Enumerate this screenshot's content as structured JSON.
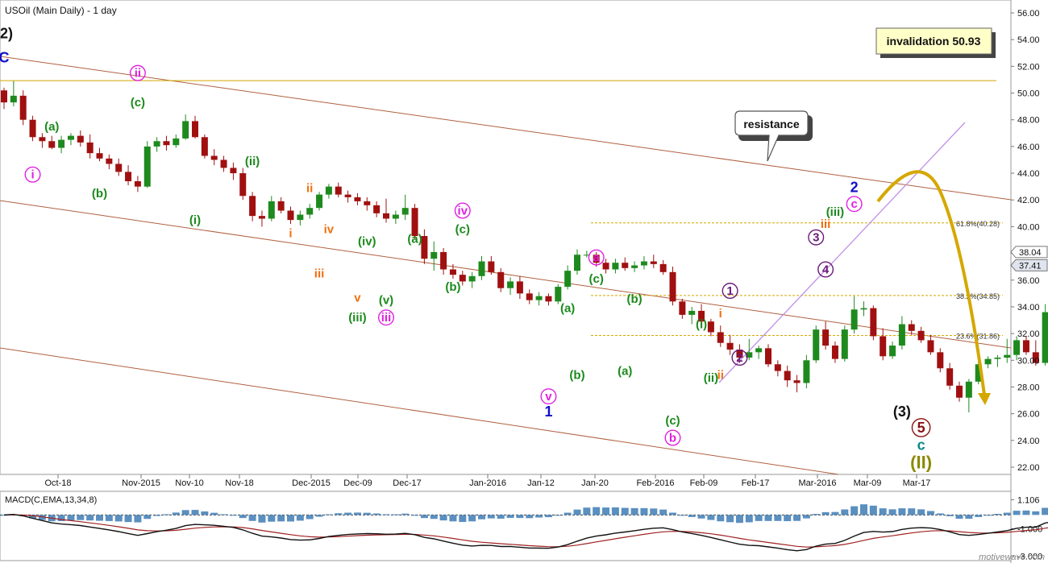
{
  "title": "USOil (Main Daily) - 1 day",
  "watermark": "motivewave.com",
  "colors": {
    "up": "#1e8a1e",
    "down": "#a01010",
    "green": "#1b8a1b",
    "magenta": "#e020e0",
    "orange": "#f07010",
    "blue": "#1010c8",
    "purple": "#6a1a7a",
    "black": "#111111",
    "darkred": "#8a1010",
    "teal": "#0a8a8a",
    "olive": "#8a8a00",
    "gold": "#d4a800",
    "channel": "#b06040",
    "lavender": "#c090e8",
    "macd_hist": "#5a8fc0",
    "macd_line": "#111111",
    "signal_line": "#a02020"
  },
  "price_axis": {
    "min": 22,
    "max": 56,
    "ticks": [
      "56.00",
      "54.00",
      "52.00",
      "50.00",
      "48.00",
      "46.00",
      "44.00",
      "42.00",
      "40.00",
      "38.00",
      "36.00",
      "34.00",
      "32.00",
      "30.00",
      "28.00",
      "26.00",
      "24.00",
      "22.00"
    ]
  },
  "last_price_tags": [
    {
      "label": "38.04",
      "value": 38.04
    },
    {
      "label": "37.41",
      "value": 37.41
    }
  ],
  "date_labels": [
    "Oct-18",
    "Nov-2015",
    "Nov-10",
    "Nov-18",
    "Dec-2015",
    "Dec-09",
    "Dec-17",
    "Jan-2016",
    "Jan-12",
    "Jan-20",
    "Feb-2016",
    "Feb-09",
    "Feb-17",
    "Mar-2016",
    "Mar-09",
    "Mar-17"
  ],
  "invalidation": {
    "label": "invalidation 50.93",
    "value": 50.93
  },
  "resistance_label": "resistance",
  "fib_levels": [
    {
      "label": "61.8%(40.28)",
      "value": 40.28
    },
    {
      "label": "38.2%(34.85)",
      "value": 34.85
    },
    {
      "label": "23.6%(31.86)",
      "value": 31.86
    }
  ],
  "macd": {
    "label": "MACD(C,EMA,13,34,8)",
    "ticks": [
      "1.106",
      "-1.000",
      "-3.000"
    ],
    "min": -3.2,
    "max": 1.6
  },
  "wave_labels": [
    {
      "text": "(2)",
      "bar": 0,
      "price": 54.1,
      "color": "black",
      "size": 18,
      "circle": false
    },
    {
      "text": "C",
      "bar": 0,
      "price": 52.3,
      "color": "blue",
      "size": 18,
      "circle": false
    },
    {
      "text": "ii",
      "bar": 14,
      "price": 51.2,
      "color": "magenta",
      "size": 15,
      "circle": true
    },
    {
      "text": "(c)",
      "bar": 14,
      "price": 49.0,
      "color": "green",
      "size": 15,
      "circle": false
    },
    {
      "text": "(a)",
      "bar": 5,
      "price": 47.2,
      "color": "green",
      "size": 15,
      "circle": false
    },
    {
      "text": "i",
      "bar": 3,
      "price": 43.6,
      "color": "magenta",
      "size": 15,
      "circle": true
    },
    {
      "text": "(b)",
      "bar": 10,
      "price": 42.2,
      "color": "green",
      "size": 15,
      "circle": false
    },
    {
      "text": "(ii)",
      "bar": 26,
      "price": 44.6,
      "color": "green",
      "size": 15,
      "circle": false
    },
    {
      "text": "(i)",
      "bar": 20,
      "price": 40.2,
      "color": "green",
      "size": 15,
      "circle": false
    },
    {
      "text": "ii",
      "bar": 32,
      "price": 42.6,
      "color": "orange",
      "size": 15,
      "circle": false
    },
    {
      "text": "iv",
      "bar": 34,
      "price": 39.5,
      "color": "orange",
      "size": 15,
      "circle": false
    },
    {
      "text": "i",
      "bar": 30,
      "price": 39.2,
      "color": "orange",
      "size": 15,
      "circle": false
    },
    {
      "text": "(iv)",
      "bar": 38,
      "price": 38.6,
      "color": "green",
      "size": 15,
      "circle": false
    },
    {
      "text": "iii",
      "bar": 33,
      "price": 36.2,
      "color": "orange",
      "size": 15,
      "circle": false
    },
    {
      "text": "v",
      "bar": 37,
      "price": 34.4,
      "color": "orange",
      "size": 15,
      "circle": false
    },
    {
      "text": "(v)",
      "bar": 40,
      "price": 34.2,
      "color": "green",
      "size": 15,
      "circle": false
    },
    {
      "text": "(iii)",
      "bar": 37,
      "price": 32.9,
      "color": "green",
      "size": 15,
      "circle": false
    },
    {
      "text": "iii",
      "bar": 40,
      "price": 32.9,
      "color": "magenta",
      "size": 15,
      "circle": true
    },
    {
      "text": "iv",
      "bar": 48,
      "price": 40.9,
      "color": "magenta",
      "size": 15,
      "circle": true
    },
    {
      "text": "(c)",
      "bar": 48,
      "price": 39.5,
      "color": "green",
      "size": 15,
      "circle": false
    },
    {
      "text": "(a)",
      "bar": 43,
      "price": 38.8,
      "color": "green",
      "size": 15,
      "circle": false
    },
    {
      "text": "(b)",
      "bar": 47,
      "price": 35.2,
      "color": "green",
      "size": 15,
      "circle": false
    },
    {
      "text": "a",
      "bar": 62,
      "price": 37.4,
      "color": "magenta",
      "size": 15,
      "circle": true
    },
    {
      "text": "(c)",
      "bar": 62,
      "price": 35.8,
      "color": "green",
      "size": 15,
      "circle": false
    },
    {
      "text": "(a)",
      "bar": 59,
      "price": 33.6,
      "color": "green",
      "size": 15,
      "circle": false
    },
    {
      "text": "(b)",
      "bar": 66,
      "price": 34.3,
      "color": "green",
      "size": 15,
      "circle": false
    },
    {
      "text": "(b)",
      "bar": 60,
      "price": 28.6,
      "color": "green",
      "size": 15,
      "circle": false
    },
    {
      "text": "(a)",
      "bar": 65,
      "price": 28.9,
      "color": "green",
      "size": 15,
      "circle": false
    },
    {
      "text": "v",
      "bar": 57,
      "price": 27.0,
      "color": "magenta",
      "size": 15,
      "circle": true
    },
    {
      "text": "1",
      "bar": 57,
      "price": 25.8,
      "color": "blue",
      "size": 18,
      "circle": false
    },
    {
      "text": "(c)",
      "bar": 70,
      "price": 25.2,
      "color": "green",
      "size": 15,
      "circle": false
    },
    {
      "text": "b",
      "bar": 70,
      "price": 23.9,
      "color": "magenta",
      "size": 15,
      "circle": true
    },
    {
      "text": "(i)",
      "bar": 73,
      "price": 32.4,
      "color": "green",
      "size": 15,
      "circle": false
    },
    {
      "text": "(ii)",
      "bar": 74,
      "price": 28.4,
      "color": "green",
      "size": 15,
      "circle": false
    },
    {
      "text": "i",
      "bar": 75,
      "price": 33.2,
      "color": "orange",
      "size": 15,
      "circle": false
    },
    {
      "text": "ii",
      "bar": 75,
      "price": 28.6,
      "color": "orange",
      "size": 15,
      "circle": false
    },
    {
      "text": "1",
      "bar": 76,
      "price": 34.9,
      "color": "purple",
      "size": 15,
      "circle": true
    },
    {
      "text": "2",
      "bar": 77,
      "price": 29.9,
      "color": "purple",
      "size": 15,
      "circle": true
    },
    {
      "text": "2",
      "bar": 89,
      "price": 42.6,
      "color": "blue",
      "size": 18,
      "circle": false
    },
    {
      "text": "c",
      "bar": 89,
      "price": 41.4,
      "color": "magenta",
      "size": 15,
      "circle": true
    },
    {
      "text": "(iii)",
      "bar": 87,
      "price": 40.8,
      "color": "green",
      "size": 15,
      "circle": false
    },
    {
      "text": "iii",
      "bar": 86,
      "price": 39.9,
      "color": "orange",
      "size": 15,
      "circle": false
    },
    {
      "text": "3",
      "bar": 85,
      "price": 38.9,
      "color": "purple",
      "size": 15,
      "circle": true
    },
    {
      "text": "4",
      "bar": 86,
      "price": 36.5,
      "color": "purple",
      "size": 15,
      "circle": true
    },
    {
      "text": "(3)",
      "bar": 94,
      "price": 25.8,
      "color": "black",
      "size": 18,
      "circle": false
    },
    {
      "text": "5",
      "bar": 96,
      "price": 24.6,
      "color": "darkred",
      "size": 18,
      "circle": true
    },
    {
      "text": "c",
      "bar": 96,
      "price": 23.3,
      "color": "teal",
      "size": 18,
      "circle": false
    },
    {
      "text": "(II)",
      "bar": 96,
      "price": 21.9,
      "color": "olive",
      "size": 22,
      "circle": false
    }
  ],
  "chart_data": {
    "type": "candlestick",
    "title": "USOil (Main Daily) - 1 day",
    "y_range": [
      22,
      56
    ],
    "x_tick_labels": [
      "Oct-18",
      "Nov-2015",
      "Nov-10",
      "Nov-18",
      "Dec-2015",
      "Dec-09",
      "Dec-17",
      "Jan-2016",
      "Jan-12",
      "Jan-20",
      "Feb-2016",
      "Feb-09",
      "Feb-17",
      "Mar-2016",
      "Mar-09",
      "Mar-17"
    ],
    "ohlc": [
      [
        50.2,
        50.4,
        48.8,
        49.3
      ],
      [
        49.3,
        50.9,
        49.0,
        49.8
      ],
      [
        49.8,
        50.2,
        47.6,
        48.0
      ],
      [
        48.0,
        48.3,
        46.4,
        46.7
      ],
      [
        46.7,
        47.0,
        45.9,
        46.4
      ],
      [
        46.4,
        46.8,
        45.8,
        45.9
      ],
      [
        45.9,
        46.8,
        45.5,
        46.5
      ],
      [
        46.5,
        47.0,
        46.1,
        46.8
      ],
      [
        46.8,
        47.2,
        46.0,
        46.3
      ],
      [
        46.3,
        46.9,
        45.1,
        45.5
      ],
      [
        45.5,
        45.9,
        44.9,
        45.1
      ],
      [
        45.1,
        45.4,
        44.3,
        44.7
      ],
      [
        44.7,
        45.1,
        43.8,
        44.1
      ],
      [
        44.1,
        44.6,
        43.1,
        43.4
      ],
      [
        43.4,
        43.8,
        42.6,
        43.0
      ],
      [
        43.0,
        46.4,
        42.9,
        46.0
      ],
      [
        46.0,
        46.7,
        45.6,
        46.4
      ],
      [
        46.4,
        46.8,
        45.7,
        46.1
      ],
      [
        46.1,
        46.9,
        45.9,
        46.6
      ],
      [
        46.6,
        48.4,
        46.5,
        47.9
      ],
      [
        47.9,
        48.3,
        46.6,
        46.7
      ],
      [
        46.7,
        46.9,
        45.1,
        45.3
      ],
      [
        45.3,
        45.8,
        44.6,
        45.0
      ],
      [
        45.0,
        45.3,
        44.1,
        44.4
      ],
      [
        44.4,
        44.8,
        43.5,
        44.0
      ],
      [
        44.0,
        44.4,
        42.0,
        42.3
      ],
      [
        42.3,
        42.6,
        40.4,
        40.8
      ],
      [
        40.8,
        41.2,
        40.0,
        40.6
      ],
      [
        40.6,
        42.3,
        40.4,
        41.9
      ],
      [
        41.9,
        42.2,
        41.0,
        41.2
      ],
      [
        41.2,
        41.5,
        40.2,
        40.5
      ],
      [
        40.5,
        41.2,
        40.1,
        40.9
      ],
      [
        40.9,
        41.7,
        40.6,
        41.4
      ],
      [
        41.4,
        42.6,
        41.2,
        42.4
      ],
      [
        42.4,
        43.2,
        42.1,
        43.0
      ],
      [
        43.0,
        43.3,
        42.2,
        42.4
      ],
      [
        42.4,
        42.7,
        41.8,
        42.2
      ],
      [
        42.2,
        42.5,
        41.6,
        41.9
      ],
      [
        41.9,
        42.2,
        41.2,
        41.6
      ],
      [
        41.6,
        41.9,
        40.7,
        41.0
      ],
      [
        41.0,
        42.1,
        40.3,
        40.6
      ],
      [
        40.6,
        41.2,
        40.2,
        40.9
      ],
      [
        40.9,
        42.4,
        40.5,
        41.4
      ],
      [
        41.4,
        41.7,
        39.1,
        39.3
      ],
      [
        39.3,
        39.8,
        37.2,
        37.6
      ],
      [
        37.6,
        38.9,
        36.7,
        38.1
      ],
      [
        38.1,
        38.4,
        36.4,
        36.8
      ],
      [
        36.8,
        37.2,
        36.1,
        36.4
      ],
      [
        36.4,
        36.7,
        35.6,
        35.9
      ],
      [
        35.9,
        36.6,
        35.4,
        36.3
      ],
      [
        36.3,
        37.8,
        36.0,
        37.4
      ],
      [
        37.4,
        37.8,
        36.4,
        36.6
      ],
      [
        36.6,
        36.9,
        35.1,
        35.4
      ],
      [
        35.4,
        36.2,
        34.9,
        35.9
      ],
      [
        35.9,
        36.3,
        34.6,
        35.0
      ],
      [
        35.0,
        35.3,
        34.2,
        34.5
      ],
      [
        34.5,
        35.1,
        34.1,
        34.8
      ],
      [
        34.8,
        35.0,
        34.1,
        34.4
      ],
      [
        34.4,
        35.7,
        34.2,
        35.5
      ],
      [
        35.5,
        37.1,
        35.3,
        36.7
      ],
      [
        36.7,
        38.3,
        36.4,
        37.9
      ],
      [
        37.9,
        38.2,
        37.7,
        37.9
      ],
      [
        37.9,
        38.1,
        37.0,
        37.3
      ],
      [
        37.3,
        37.6,
        36.5,
        36.8
      ],
      [
        36.8,
        37.6,
        36.5,
        37.3
      ],
      [
        37.3,
        37.7,
        36.7,
        36.9
      ],
      [
        36.9,
        37.4,
        36.6,
        37.1
      ],
      [
        37.1,
        37.8,
        36.8,
        37.4
      ],
      [
        37.4,
        37.9,
        36.9,
        37.2
      ],
      [
        37.2,
        37.5,
        36.4,
        36.6
      ],
      [
        36.6,
        37.0,
        34.1,
        34.4
      ]
    ],
    "ohlc_2": [
      [
        34.4,
        34.6,
        33.1,
        33.4
      ],
      [
        33.4,
        34.0,
        32.7,
        33.7
      ],
      [
        33.7,
        34.2,
        32.5,
        32.9
      ],
      [
        32.9,
        33.1,
        31.8,
        32.1
      ],
      [
        32.1,
        32.6,
        31.0,
        31.3
      ],
      [
        31.3,
        31.9,
        30.4,
        30.8
      ],
      [
        30.8,
        31.2,
        29.8,
        30.2
      ],
      [
        30.2,
        31.6,
        30.0,
        30.6
      ],
      [
        30.6,
        31.1,
        30.1,
        30.9
      ],
      [
        30.9,
        31.2,
        29.5,
        29.7
      ],
      [
        29.7,
        30.0,
        28.8,
        29.2
      ],
      [
        29.2,
        29.6,
        28.0,
        28.5
      ],
      [
        28.5,
        28.9,
        27.6,
        28.3
      ],
      [
        28.3,
        30.4,
        27.9,
        30.0
      ],
      [
        30.0,
        32.6,
        29.8,
        32.3
      ],
      [
        32.3,
        32.9,
        30.8,
        31.1
      ],
      [
        31.1,
        31.4,
        29.8,
        30.1
      ],
      [
        30.1,
        32.6,
        29.9,
        32.3
      ],
      [
        32.3,
        34.8,
        32.0,
        33.8
      ],
      [
        33.8,
        34.4,
        33.3,
        33.9
      ],
      [
        33.9,
        34.1,
        31.5,
        31.8
      ],
      [
        31.8,
        32.4,
        30.0,
        30.3
      ],
      [
        30.3,
        31.4,
        30.1,
        31.1
      ],
      [
        31.1,
        33.3,
        30.8,
        32.7
      ],
      [
        32.7,
        33.0,
        31.9,
        32.2
      ],
      [
        32.2,
        32.5,
        31.3,
        31.5
      ],
      [
        31.5,
        31.9,
        30.4,
        30.6
      ],
      [
        30.6,
        30.9,
        29.1,
        29.4
      ],
      [
        29.4,
        29.8,
        27.8,
        28.1
      ],
      [
        28.1,
        28.4,
        26.9,
        27.2
      ],
      [
        27.2,
        28.6,
        26.1,
        28.4
      ],
      [
        28.4,
        30.0,
        28.2,
        29.7
      ],
      [
        29.7,
        30.3,
        29.4,
        30.1
      ],
      [
        30.1,
        30.4,
        29.5,
        30.2
      ],
      [
        30.2,
        31.6,
        29.8,
        30.4
      ],
      [
        30.4,
        31.8,
        30.0,
        31.5
      ],
      [
        31.5,
        31.8,
        30.4,
        30.6
      ],
      [
        30.6,
        31.5,
        29.6,
        29.8
      ],
      [
        29.8,
        34.2,
        29.6,
        33.6
      ],
      [
        33.6,
        34.0,
        31.3,
        31.6
      ],
      [
        31.6,
        32.4,
        31.1,
        32.1
      ],
      [
        32.1,
        32.8,
        31.9,
        32.7
      ],
      [
        32.7,
        34.6,
        32.6,
        33.1
      ],
      [
        33.1,
        34.3,
        32.8,
        33.5
      ],
      [
        33.5,
        34.6,
        33.4,
        34.3
      ],
      [
        34.3,
        35.0,
        34.0,
        34.7
      ],
      [
        34.7,
        35.6,
        34.6,
        35.2
      ],
      [
        35.2,
        36.5,
        35.0,
        36.2
      ],
      [
        36.2,
        38.0,
        36.0,
        37.8
      ],
      [
        37.8,
        38.1,
        37.2,
        37.4
      ]
    ],
    "invalidation": 50.93,
    "fib_retracements": [
      {
        "label": "61.8%(40.28)",
        "value": 40.28
      },
      {
        "label": "38.2%(34.85)",
        "value": 34.85
      },
      {
        "label": "23.6%(31.86)",
        "value": 31.86
      }
    ],
    "indicator": {
      "name": "MACD(C,EMA,13,34,8)",
      "y_ticks": [
        1.106,
        -1.0,
        -3.0
      ]
    }
  }
}
